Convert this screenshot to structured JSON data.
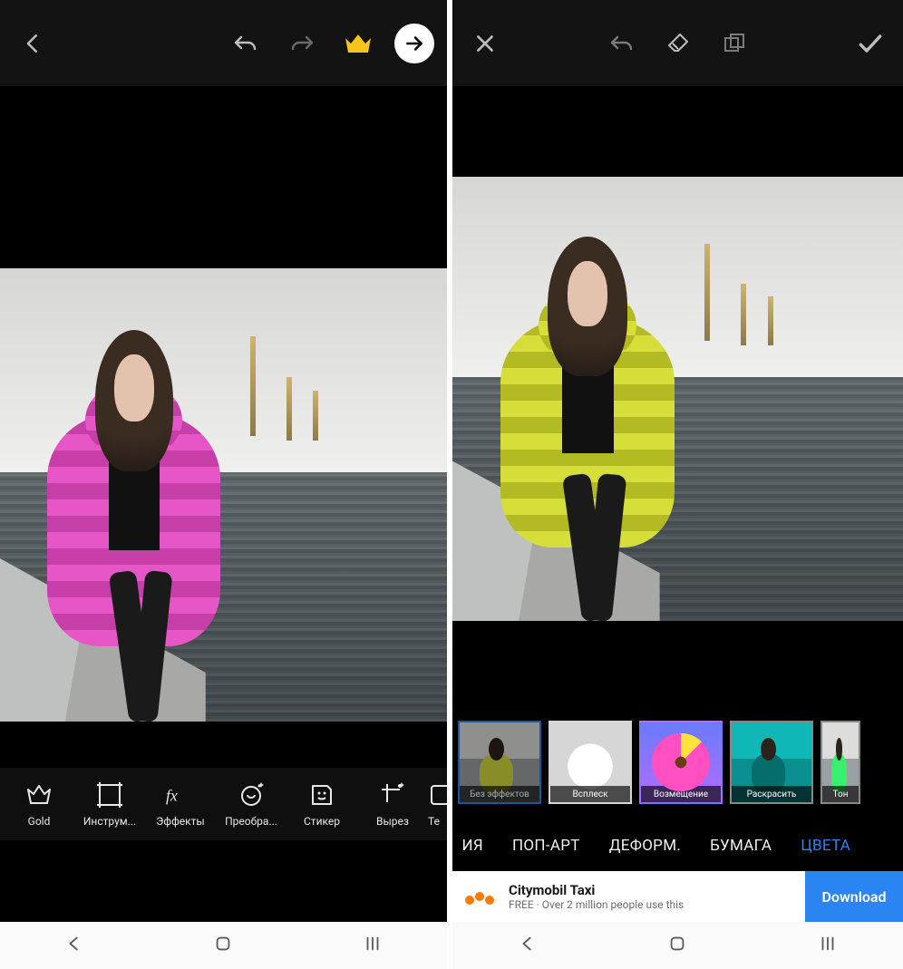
{
  "colors": {
    "gold": "#f8c31a",
    "accent": "#2a84f2"
  },
  "left": {
    "toolbar": {
      "icons": {
        "back": "arrow-left",
        "undo": "undo",
        "redo": "redo",
        "premium": "crown",
        "next": "arrow-right"
      }
    },
    "tools": [
      {
        "icon": "crown-outline",
        "label": "Gold"
      },
      {
        "icon": "crop",
        "label": "Инструм..."
      },
      {
        "icon": "fx",
        "label": "Эффекты"
      },
      {
        "icon": "beautify",
        "label": "Преобра..."
      },
      {
        "icon": "sticker",
        "label": "Стикер"
      },
      {
        "icon": "cutout",
        "label": "Вырез"
      },
      {
        "icon": "text",
        "label": "Те"
      }
    ]
  },
  "right": {
    "toolbar": {
      "icons": {
        "close": "close",
        "undo": "undo",
        "eraser": "eraser",
        "layers": "layers",
        "apply": "check"
      }
    },
    "thumbnails": [
      {
        "variant": "none",
        "label": "Без эффектов",
        "selected": true
      },
      {
        "variant": "splash",
        "label": "Всплеск"
      },
      {
        "variant": "replace",
        "label": "Возмещение"
      },
      {
        "variant": "colorize",
        "label": "Раскрасить"
      },
      {
        "variant": "tone",
        "label": "Тон",
        "partial": true
      }
    ],
    "categories": [
      {
        "label": "ИЯ",
        "partial": true
      },
      {
        "label": "ПОП-АРТ"
      },
      {
        "label": "ДЕФОРМ."
      },
      {
        "label": "БУМАГА"
      },
      {
        "label": "ЦВЕТА",
        "active": true
      }
    ],
    "ad": {
      "title": "Citymobil Taxi",
      "subtitle": "FREE · Over 2 million people use this",
      "cta": "Download"
    }
  }
}
